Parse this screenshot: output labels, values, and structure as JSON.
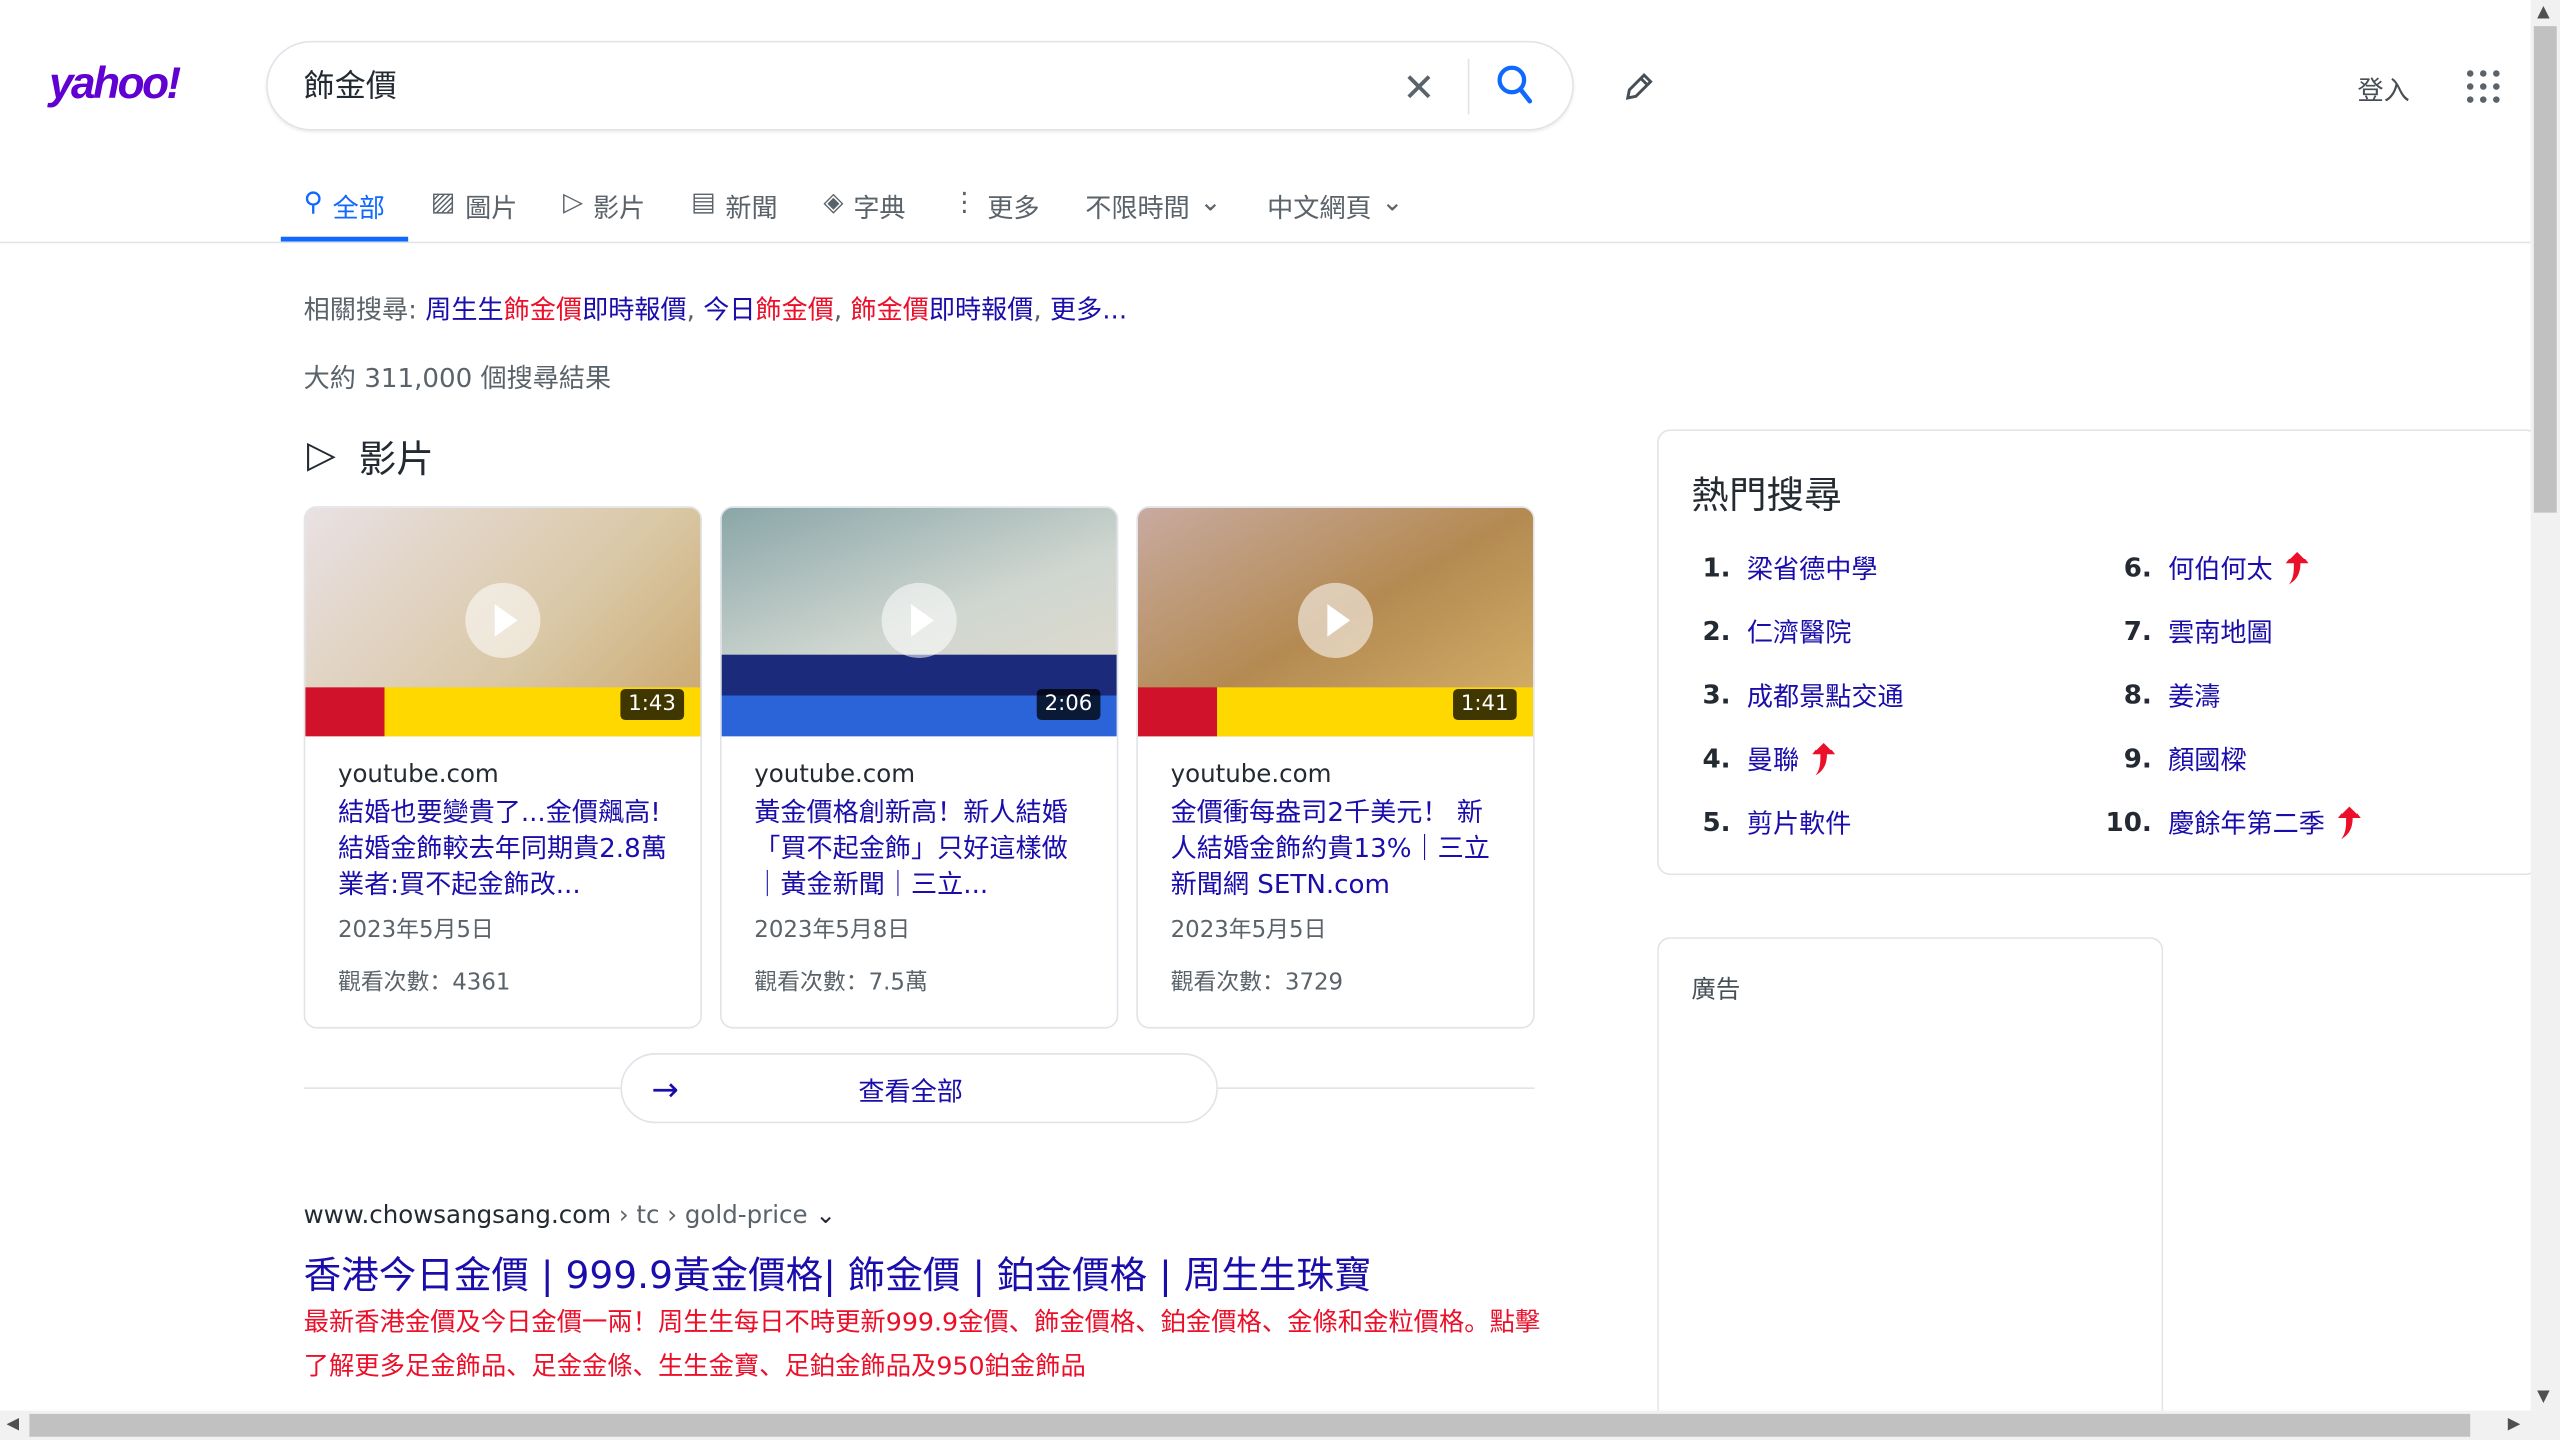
{
  "header": {
    "logo": "yahoo!",
    "query": "飾金價",
    "login": "登入"
  },
  "tabs": [
    {
      "label": "全部",
      "icon": "search-icon"
    },
    {
      "label": "圖片",
      "icon": "image-icon"
    },
    {
      "label": "影片",
      "icon": "play-icon"
    },
    {
      "label": "新聞",
      "icon": "news-icon"
    },
    {
      "label": "字典",
      "icon": "dictionary-icon"
    },
    {
      "label": "更多",
      "icon": "more-icon"
    },
    {
      "label": "不限時間",
      "icon": "chevron-down-icon"
    },
    {
      "label": "中文網頁",
      "icon": "chevron-down-icon"
    }
  ],
  "related": {
    "label": "相關搜尋:",
    "items": [
      [
        "周生生",
        "飾金價",
        "即時報價"
      ],
      [
        "今日",
        "飾金價",
        ""
      ],
      [
        "",
        "飾金價",
        "即時報價"
      ]
    ],
    "more": "更多..."
  },
  "result_count": "大約 311,000 個搜尋結果",
  "videos": {
    "heading": "影片",
    "see_all": "查看全部",
    "items": [
      {
        "source": "youtube.com",
        "title": "結婚也要變貴了...金價飆高! 結婚金飾較去年同期貴2.8萬 業者:買不起金飾改...",
        "date": "2023年5月5日",
        "views": "觀看次數：4361",
        "duration": "1:43"
      },
      {
        "source": "youtube.com",
        "title": "黃金價格創新高！新人結婚「買不起金飾」只好這樣做｜黃金新聞｜三立...",
        "date": "2023年5月8日",
        "views": "觀看次數：7.5萬",
        "duration": "2:06"
      },
      {
        "source": "youtube.com",
        "title": "金價衝每盎司2千美元！ 新人結婚金飾約貴13%｜三立新聞網 SETN.com",
        "date": "2023年5月5日",
        "views": "觀看次數：3729",
        "duration": "1:41"
      }
    ]
  },
  "result": {
    "domain": "www.chowsangsang.com",
    "crumbs": " › tc › gold-price",
    "title": "香港今日金價 | 999.9黃金價格| 飾金價 | 鉑金價格 | 周生生珠寶",
    "description": "最新香港金價及今日金價一兩！周生生每日不時更新999.9金價、飾金價格、鉑金價格、金條和金粒價格。點擊了解更多足金飾品、足金金條、生生金寶、足鉑金飾品及950鉑金飾品"
  },
  "trending": {
    "title": "熱門搜尋",
    "items": [
      {
        "rank": "1.",
        "label": "梁省德中學",
        "hot": false
      },
      {
        "rank": "2.",
        "label": "仁濟醫院",
        "hot": false
      },
      {
        "rank": "3.",
        "label": "成都景點交通",
        "hot": false
      },
      {
        "rank": "4.",
        "label": "曼聯",
        "hot": true
      },
      {
        "rank": "5.",
        "label": "剪片軟件",
        "hot": false
      },
      {
        "rank": "6.",
        "label": "何伯何太",
        "hot": true
      },
      {
        "rank": "7.",
        "label": "雲南地圖",
        "hot": false
      },
      {
        "rank": "8.",
        "label": "姜濤",
        "hot": false
      },
      {
        "rank": "9.",
        "label": "顏國樑",
        "hot": false
      },
      {
        "rank": "10.",
        "label": "慶餘年第二季",
        "hot": true
      }
    ]
  },
  "ad": {
    "label": "廣告"
  },
  "colors": {
    "link": "#1a0dab",
    "accent": "#0f69ff",
    "highlight": "#eb0f29",
    "brand": "#6001d2"
  }
}
